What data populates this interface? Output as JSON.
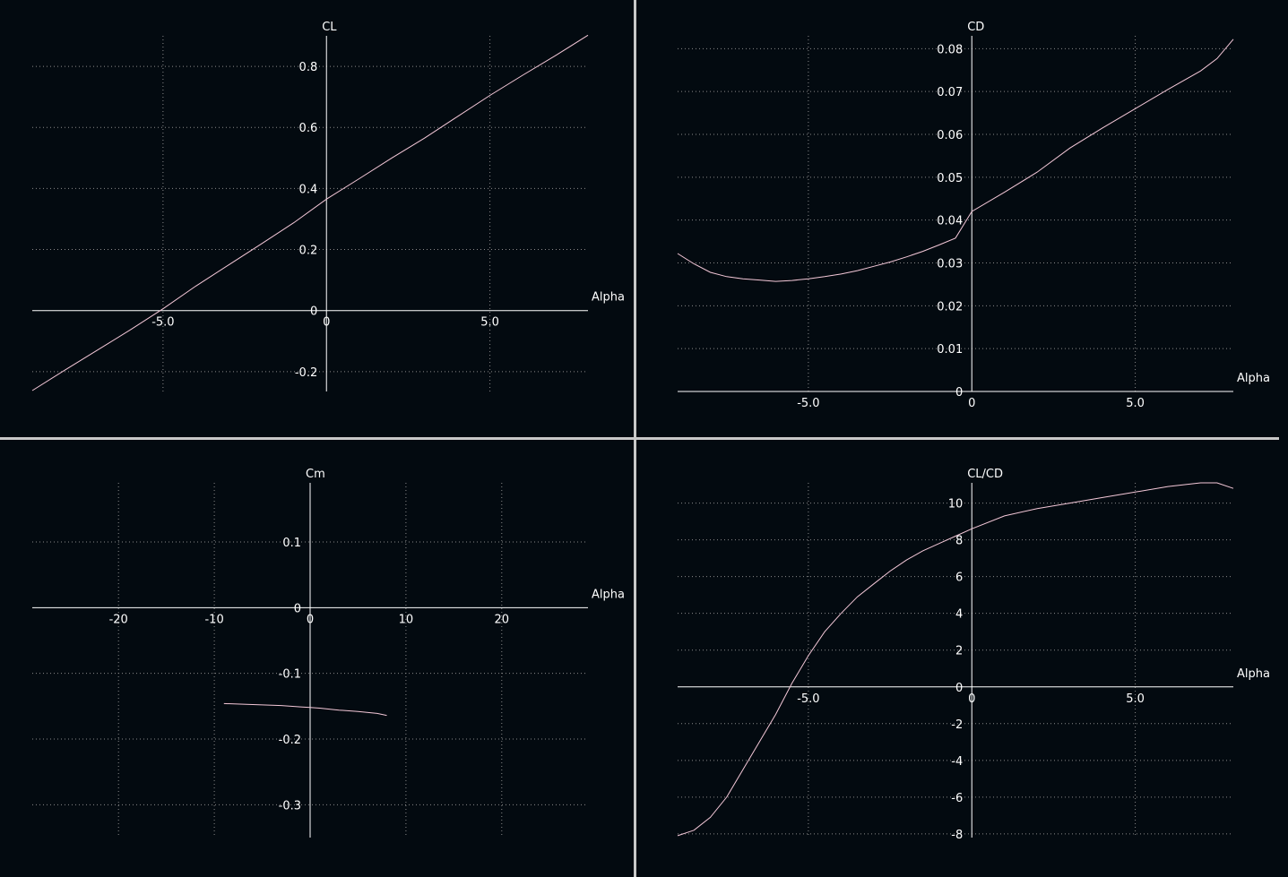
{
  "colors": {
    "background": "#030a10",
    "divider": "#c8c8c8",
    "axis": "#ffffff",
    "grid": "#8a8a8a",
    "curve": "#f4c8d8"
  },
  "chart_data": [
    {
      "type": "line",
      "ylabel": "CL",
      "xlabel": "Alpha",
      "xlim": [
        -9,
        8
      ],
      "ylim": [
        -0.265,
        0.9
      ],
      "xticks": [
        -5,
        0,
        5
      ],
      "xtick_labels": [
        "-5.0",
        "0",
        "5.0"
      ],
      "yticks": [
        -0.2,
        0,
        0.2,
        0.4,
        0.6,
        0.8
      ],
      "ytick_labels": [
        "-0.2",
        "0",
        "0.2",
        "0.4",
        "0.6",
        "0.8"
      ],
      "grid": true,
      "series": [
        {
          "x": [
            -9,
            -8,
            -7,
            -6,
            -5,
            -4,
            -3,
            -2,
            -1,
            0,
            1,
            2,
            3,
            4,
            5,
            6,
            7,
            8
          ],
          "y": [
            -0.262,
            -0.195,
            -0.129,
            -0.063,
            0.006,
            0.08,
            0.149,
            0.218,
            0.288,
            0.365,
            0.432,
            0.5,
            0.565,
            0.635,
            0.705,
            0.771,
            0.835,
            0.902
          ]
        }
      ]
    },
    {
      "type": "line",
      "ylabel": "CD",
      "xlabel": "Alpha",
      "xlim": [
        -9,
        8
      ],
      "ylim": [
        0,
        0.083
      ],
      "xticks": [
        -5,
        0,
        5
      ],
      "xtick_labels": [
        "-5.0",
        "0",
        "5.0"
      ],
      "yticks": [
        0,
        0.01,
        0.02,
        0.03,
        0.04,
        0.05,
        0.06,
        0.07,
        0.08
      ],
      "ytick_labels": [
        "0",
        "0.01",
        "0.02",
        "0.03",
        "0.04",
        "0.05",
        "0.06",
        "0.07",
        "0.08"
      ],
      "grid": true,
      "series": [
        {
          "x": [
            -9,
            -8.5,
            -8,
            -7.5,
            -7,
            -6.5,
            -6,
            -5.5,
            -5,
            -4.5,
            -4,
            -3.5,
            -3,
            -2.5,
            -2,
            -1.5,
            -1,
            -0.5,
            0,
            1,
            2,
            3,
            4,
            5,
            6,
            7,
            7.5,
            8
          ],
          "y": [
            0.0322,
            0.0298,
            0.0278,
            0.0268,
            0.0263,
            0.026,
            0.0257,
            0.0259,
            0.0263,
            0.0268,
            0.0274,
            0.0282,
            0.0292,
            0.0302,
            0.0314,
            0.0327,
            0.0342,
            0.0358,
            0.042,
            0.0465,
            0.0512,
            0.0568,
            0.0615,
            0.066,
            0.0705,
            0.0748,
            0.0777,
            0.0822
          ]
        }
      ]
    },
    {
      "type": "line",
      "ylabel": "Cm",
      "xlabel": "Alpha",
      "xlim": [
        -29,
        29
      ],
      "ylim": [
        -0.35,
        0.19
      ],
      "xticks": [
        -20,
        -10,
        0,
        10,
        20
      ],
      "xtick_labels": [
        "-20",
        "-10",
        "0",
        "10",
        "20"
      ],
      "yticks": [
        -0.3,
        -0.2,
        -0.1,
        0,
        0.1
      ],
      "ytick_labels": [
        "-0.3",
        "-0.2",
        "-0.1",
        "0",
        "0.1"
      ],
      "grid": true,
      "series": [
        {
          "x": [
            -9,
            -7,
            -5,
            -3,
            -1,
            0,
            1,
            3,
            5,
            7,
            8
          ],
          "y": [
            -0.146,
            -0.147,
            -0.148,
            -0.149,
            -0.151,
            -0.152,
            -0.153,
            -0.156,
            -0.158,
            -0.161,
            -0.164
          ]
        }
      ]
    },
    {
      "type": "line",
      "ylabel": "CL/CD",
      "xlabel": "Alpha",
      "xlim": [
        -9,
        8
      ],
      "ylim": [
        -8.2,
        11.1
      ],
      "xticks": [
        -5,
        0,
        5
      ],
      "xtick_labels": [
        "-5.0",
        "0",
        "5.0"
      ],
      "yticks": [
        -8,
        -6,
        -4,
        -2,
        0,
        2,
        4,
        6,
        8,
        10
      ],
      "ytick_labels": [
        "-8",
        "-6",
        "-4",
        "-2",
        "0",
        "2",
        "4",
        "6",
        "8",
        "10"
      ],
      "grid": true,
      "series": [
        {
          "x": [
            -9,
            -8.5,
            -8,
            -7.5,
            -7,
            -6.5,
            -6,
            -5.5,
            -5,
            -4.5,
            -4,
            -3.5,
            -3,
            -2.5,
            -2,
            -1.5,
            -1,
            -0.5,
            0,
            1,
            2,
            3,
            4,
            5,
            6,
            7,
            7.5,
            8
          ],
          "y": [
            -8.1,
            -7.8,
            -7.1,
            -6.0,
            -4.5,
            -3.0,
            -1.5,
            0.2,
            1.7,
            3.0,
            4.0,
            4.9,
            5.6,
            6.3,
            6.9,
            7.4,
            7.8,
            8.2,
            8.6,
            9.3,
            9.7,
            10.0,
            10.3,
            10.6,
            10.9,
            11.1,
            11.1,
            10.8
          ]
        }
      ]
    }
  ]
}
